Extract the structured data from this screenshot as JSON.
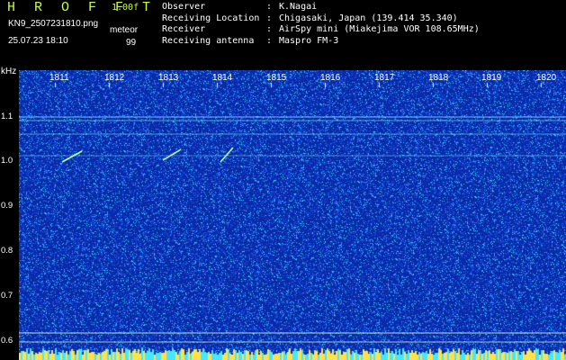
{
  "header": {
    "app_title": "H R O F F T",
    "version": "1.00f",
    "filename": "KN9_2507231810.png",
    "datetime": "25.07.23 18:10",
    "mode": "meteor",
    "count": "99"
  },
  "info": [
    {
      "key": "Observer",
      "sep": ":",
      "value": "K.Nagai"
    },
    {
      "key": "Receiving Location",
      "sep": ":",
      "value": "Chigasaki, Japan (139.414 35.340)"
    },
    {
      "key": "Receiver",
      "sep": ":",
      "value": "AirSpy mini (Miakejima VOR 108.65MHz)"
    },
    {
      "key": "Receiving antenna",
      "sep": ":",
      "value": "Maspro FM-3"
    }
  ],
  "axis": {
    "y_unit": "kHz",
    "y_labels": [
      "1.1",
      "1.0",
      "0.9",
      "0.8",
      "0.7",
      "0.6"
    ],
    "x_labels": [
      "1811",
      "1812",
      "1813",
      "1814",
      "1815",
      "1816",
      "1817",
      "1818",
      "1819",
      "1820"
    ]
  },
  "colors": {
    "background": "#0a2aa8",
    "noise_light": "#3ad0ff",
    "noise_mid": "#1a66ff",
    "signal": "#9affd6",
    "title_accent": "#c8ff2e",
    "bottom_band": "#ffe24a"
  }
}
